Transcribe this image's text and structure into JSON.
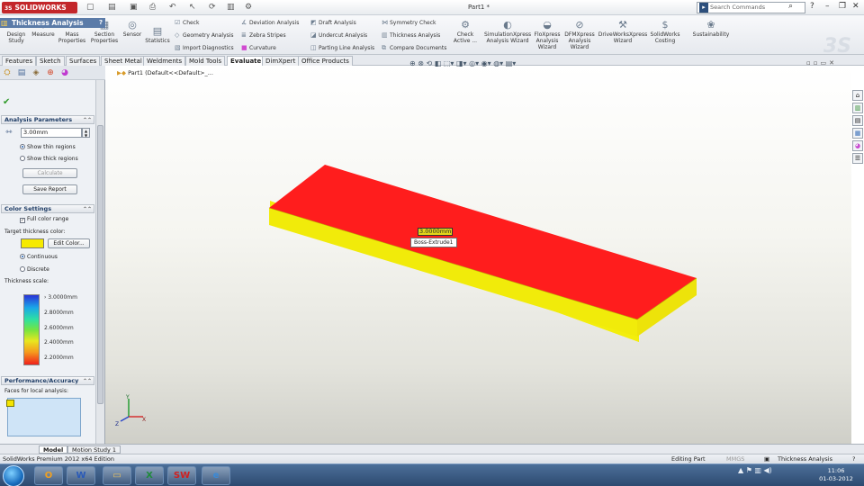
{
  "titlebar": {
    "app_name": "SOLIDWORKS",
    "brand_mark": "3S",
    "doc_title": "Part1 *",
    "search_placeholder": "Search Commands",
    "colors": {
      "brand": "#c3262a"
    }
  },
  "ribbon": {
    "big_buttons": [
      {
        "label_1": "Design",
        "label_2": "Study"
      },
      {
        "label_1": "Measure",
        "label_2": ""
      },
      {
        "label_1": "Mass",
        "label_2": "Properties"
      },
      {
        "label_1": "Section",
        "label_2": "Properties"
      },
      {
        "label_1": "Sensor",
        "label_2": ""
      },
      {
        "label_1": "Statistics",
        "label_2": ""
      }
    ],
    "small_buttons": [
      "Check",
      "Geometry Analysis",
      "Import Diagnostics",
      "Deviation Analysis",
      "Zebra Stripes",
      "Curvature",
      "Draft Analysis",
      "Undercut Analysis",
      "Parting Line Analysis",
      "Symmetry Check",
      "Thickness Analysis",
      "Compare Documents"
    ],
    "right_buttons": [
      {
        "label_1": "Check",
        "label_2": "Active ..."
      },
      {
        "label_1": "SimulationXpress",
        "label_2": "Analysis Wizard",
        "label_3": ""
      },
      {
        "label_1": "FloXpress",
        "label_2": "Analysis",
        "label_3": "Wizard"
      },
      {
        "label_1": "DFMXpress",
        "label_2": "Analysis",
        "label_3": "Wizard"
      },
      {
        "label_1": "DriveWorksXpress",
        "label_2": "Wizard",
        "label_3": ""
      },
      {
        "label_1": "SolidWorks",
        "label_2": "Costing",
        "label_3": ""
      },
      {
        "label_1": "Sustainability",
        "label_2": "",
        "label_3": ""
      }
    ]
  },
  "tabs": [
    "Features",
    "Sketch",
    "Surfaces",
    "Sheet Metal",
    "Weldments",
    "Mold Tools",
    "Evaluate",
    "DimXpert",
    "Office Products"
  ],
  "active_tab": "Evaluate",
  "property_manager": {
    "title": "Thickness Analysis",
    "analysis_parameters": {
      "header": "Analysis Parameters",
      "thickness_value": "3.00mm",
      "radio_thin": "Show thin regions",
      "radio_thick": "Show thick regions",
      "calculate": "Calculate",
      "save_report": "Save Report"
    },
    "color_settings": {
      "header": "Color Settings",
      "full_color_range": "Full color range",
      "target_label": "Target thickness color:",
      "edit_color": "Edit Color...",
      "continuous": "Continuous",
      "discrete": "Discrete",
      "scale_label": "Thickness scale:",
      "scale_values": [
        "3.0000mm",
        "2.8000mm",
        "2.6000mm",
        "2.4000mm",
        "2.2000mm"
      ],
      "target_color": "#f6ea00"
    },
    "performance": {
      "header": "Performance/Accuracy",
      "faces_label": "Faces for local analysis:"
    }
  },
  "viewport": {
    "tree_root": "Part1  (Default<<Default>_...",
    "tooltip": "Boss-Extrude1",
    "thickness_tag": "3.0000mm",
    "colors": {
      "top_face": "#ff1d1d",
      "side_face": "#f3ee0c"
    }
  },
  "bottom_tabs": [
    "Model",
    "Motion Study 1"
  ],
  "statusbar": {
    "edition": "SolidWorks Premium 2012 x64 Edition",
    "editing": "Editing Part",
    "units": "MMGS",
    "right_status": "Thickness Analysis"
  },
  "taskbar": {
    "apps": [
      "outlook",
      "word",
      "explorer",
      "excel",
      "solidworks",
      "ie"
    ],
    "clock_time": "11:06",
    "clock_date": "01-03-2012"
  }
}
